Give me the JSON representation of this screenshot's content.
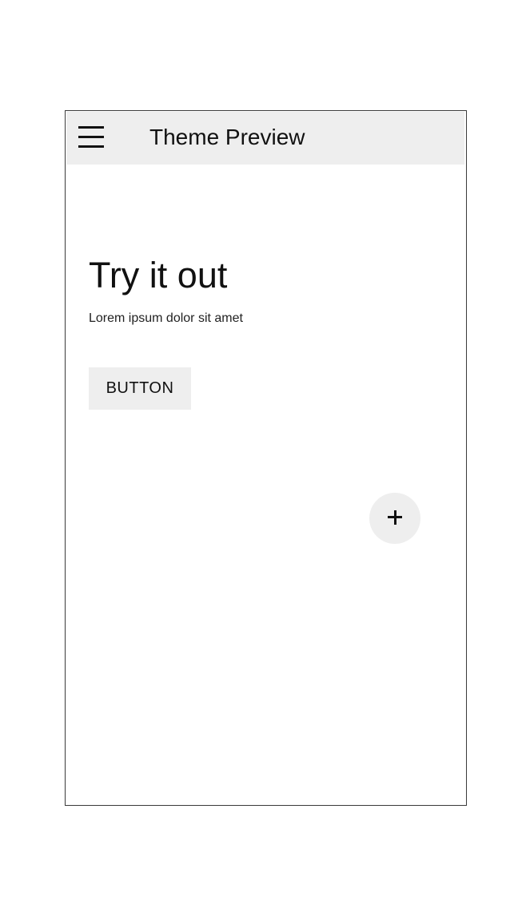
{
  "appbar": {
    "title": "Theme Preview",
    "menu_icon": "hamburger-menu-icon"
  },
  "main": {
    "heading": "Try it out",
    "body": "Lorem ipsum dolor sit amet",
    "button_label": "BUTTON"
  },
  "fab": {
    "icon": "plus-icon"
  },
  "colors": {
    "surface": "#eeeeee",
    "text": "#111111",
    "background": "#ffffff",
    "frame_border": "#3a3a3a"
  }
}
